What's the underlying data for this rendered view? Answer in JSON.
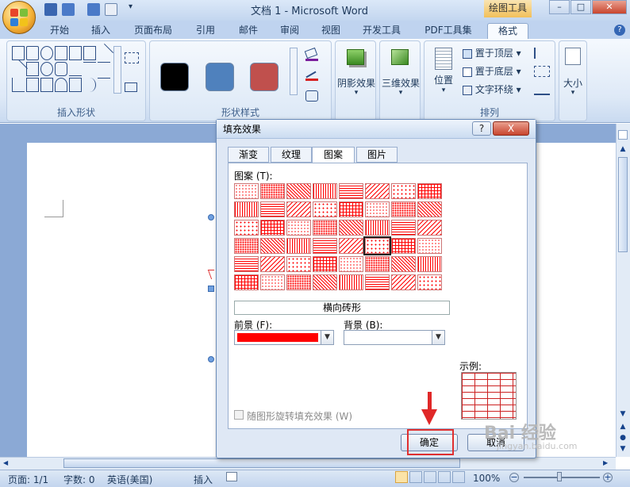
{
  "titlebar": {
    "document_title": "文档 1 - Microsoft Word",
    "context_tab_title": "绘图工具",
    "minimize": "–",
    "restore": "□"
  },
  "ribbon": {
    "tabs": [
      "开始",
      "插入",
      "页面布局",
      "引用",
      "邮件",
      "审阅",
      "视图",
      "开发工具",
      "PDF工具集",
      "格式"
    ],
    "active_tab": "格式",
    "groups": {
      "insert_shapes": "插入形状",
      "shape_styles": "形状样式",
      "shadow_effects": "阴影效果",
      "three_d_effects": "三维效果",
      "arrange": "排列",
      "size": "大小"
    },
    "style_swatches": [
      "#000000",
      "#4f81bd",
      "#c0504d"
    ],
    "arrange_items": {
      "position": "位置",
      "bring_to_front": "置于顶层",
      "send_to_back": "置于底层",
      "text_wrap": "文字环绕"
    }
  },
  "dialog": {
    "title": "填充效果",
    "help": "?",
    "close": "X",
    "tabs": [
      "渐变",
      "纹理",
      "图案",
      "图片"
    ],
    "active_tab": "图案",
    "pattern_label": "图案 (T):",
    "selected_pattern_name": "横向砖形",
    "foreground_label": "前景 (F):",
    "background_label": "背景 (B):",
    "foreground_color": "#ff0000",
    "background_color": "#ffffff",
    "sample_label": "示例:",
    "rotate_checkbox_label": "随图形旋转填充效果 (W)",
    "ok_button": "确定",
    "cancel_button": "取消"
  },
  "statusbar": {
    "page": "页面: 1/1",
    "words": "字数: 0",
    "language": "英语(美国)",
    "mode": "插入",
    "zoom": "100%"
  },
  "watermark": {
    "text": "Bai 经验",
    "sub": "jingyan.baidu.com"
  }
}
